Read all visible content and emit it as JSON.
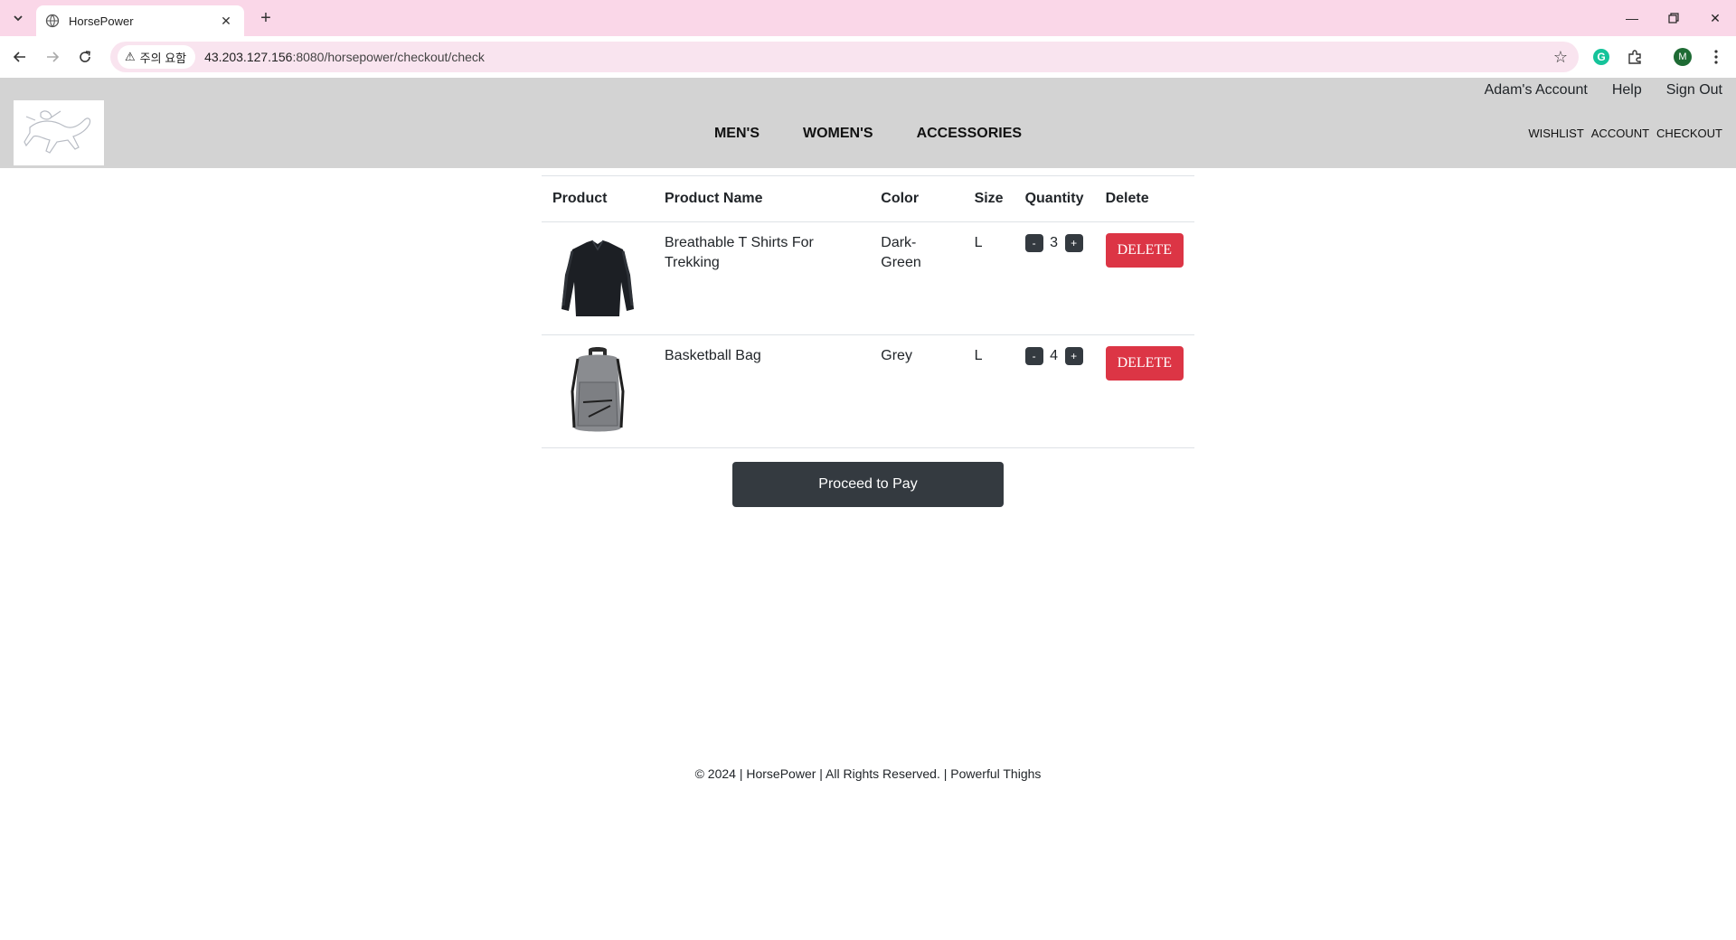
{
  "browser": {
    "tab_title": "HorsePower",
    "security_chip": "주의 요함",
    "url_host": "43.203.127.156",
    "url_rest": ":8080/horsepower/checkout/check",
    "profile_initial": "M"
  },
  "header": {
    "top_links": [
      "Adam's Account",
      "Help",
      "Sign Out"
    ],
    "main_nav": [
      "MEN'S",
      "WOMEN'S",
      "ACCESSORIES"
    ],
    "util_links": [
      "WISHLIST",
      "ACCOUNT",
      "CHECKOUT"
    ]
  },
  "cart": {
    "columns": [
      "Product",
      "Product Name",
      "Color",
      "Size",
      "Quantity",
      "Delete"
    ],
    "rows": [
      {
        "image": "black-long-sleeve-shirt",
        "name": "Breathable T Shirts For Trekking",
        "color": "Dark-Green",
        "size": "L",
        "quantity": "3",
        "minus": "-",
        "plus": "+",
        "delete": "DELETE"
      },
      {
        "image": "grey-backpack",
        "name": "Basketball Bag",
        "color": "Grey",
        "size": "L",
        "quantity": "4",
        "minus": "-",
        "plus": "+",
        "delete": "DELETE"
      }
    ],
    "pay_button": "Proceed to Pay"
  },
  "footer": {
    "text": "© 2024 | HorsePower | All Rights Reserved. | Powerful Thighs"
  },
  "colors": {
    "tabstrip": "#fad7e8",
    "header_bg": "#d3d3d3",
    "delete": "#dc3545",
    "dark_button": "#343a40"
  }
}
